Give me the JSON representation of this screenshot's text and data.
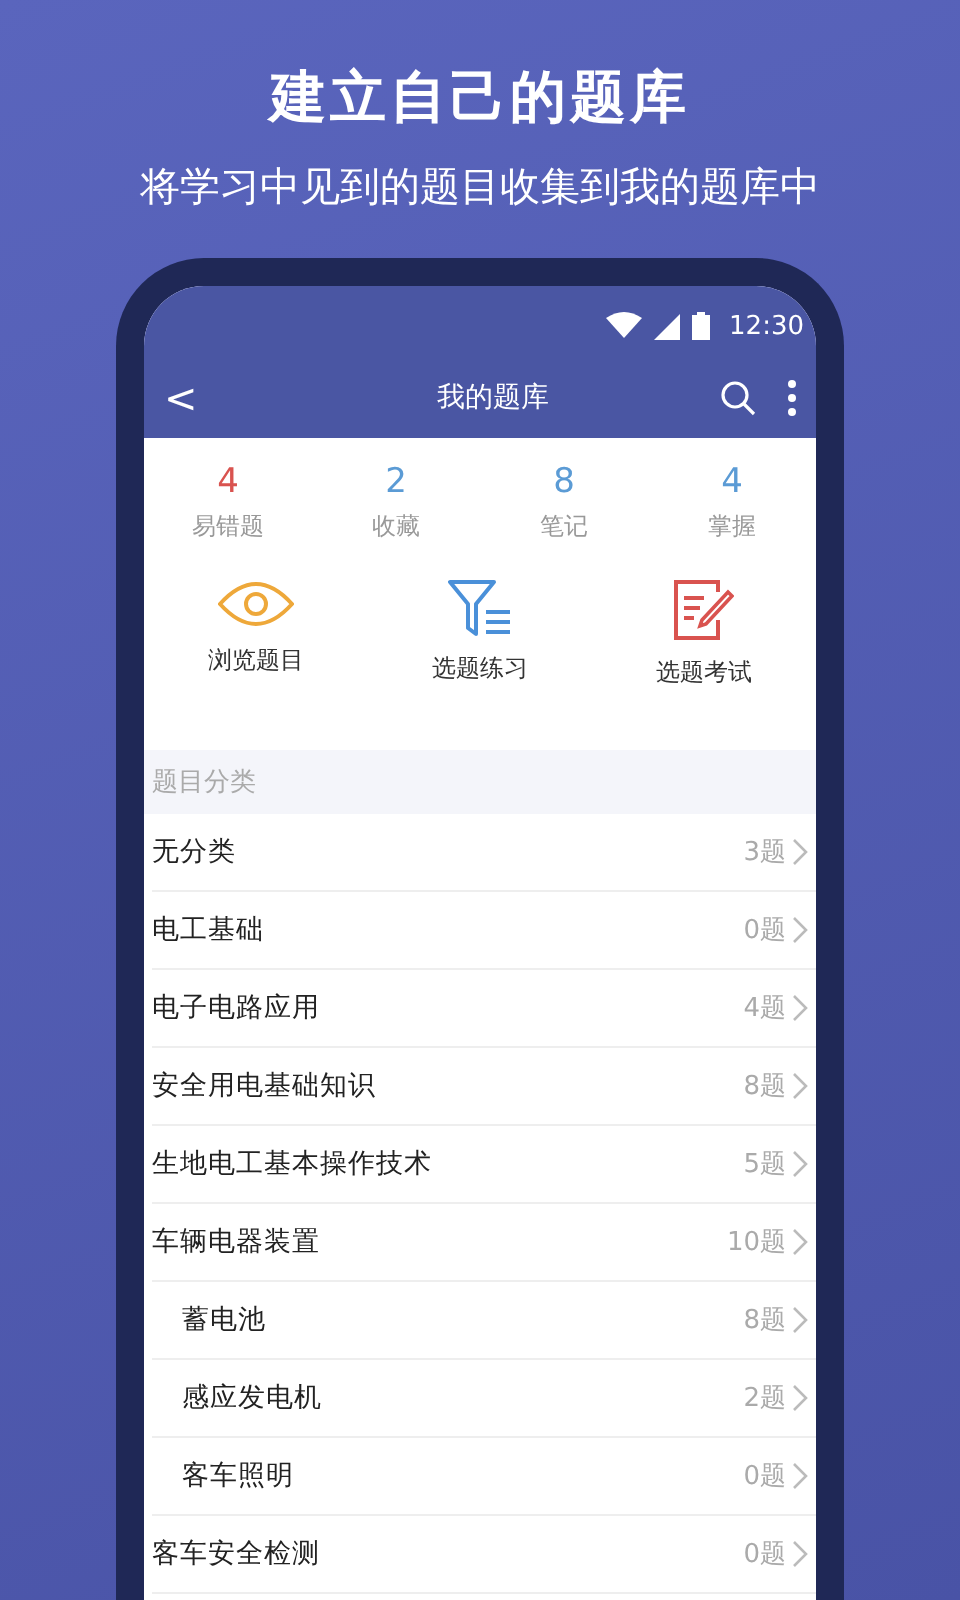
{
  "headline": "建立自己的题库",
  "subtitle": "将学习中见到的题目收集到我的题库中",
  "status_bar": {
    "time": "12:30"
  },
  "toolbar": {
    "back": "<",
    "title": "我的题库"
  },
  "stats": [
    {
      "value": "4",
      "label": "易错题",
      "color": "#d9534f"
    },
    {
      "value": "2",
      "label": "收藏",
      "color": "#5b9bd5"
    },
    {
      "value": "8",
      "label": "笔记",
      "color": "#5b9bd5"
    },
    {
      "value": "4",
      "label": "掌握",
      "color": "#5b9bd5"
    }
  ],
  "actions": [
    {
      "kind": "eye",
      "label": "浏览题目"
    },
    {
      "kind": "filter",
      "label": "选题练习"
    },
    {
      "kind": "exam",
      "label": "选题考试"
    }
  ],
  "section_title": "题目分类",
  "categories": [
    {
      "name": "无分类",
      "count": "3题"
    },
    {
      "name": "电工基础",
      "count": "0题"
    },
    {
      "name": "电子电路应用",
      "count": "4题"
    },
    {
      "name": "安全用电基础知识",
      "count": "8题"
    },
    {
      "name": "生地电工基本操作技术",
      "count": "5题"
    },
    {
      "name": "车辆电器装置",
      "count": "10题",
      "children": [
        {
          "name": "蓄电池",
          "count": "8题"
        },
        {
          "name": "感应发电机",
          "count": "2题"
        },
        {
          "name": "客车照明",
          "count": "0题"
        }
      ]
    },
    {
      "name": "客车安全检测",
      "count": "0题"
    }
  ]
}
